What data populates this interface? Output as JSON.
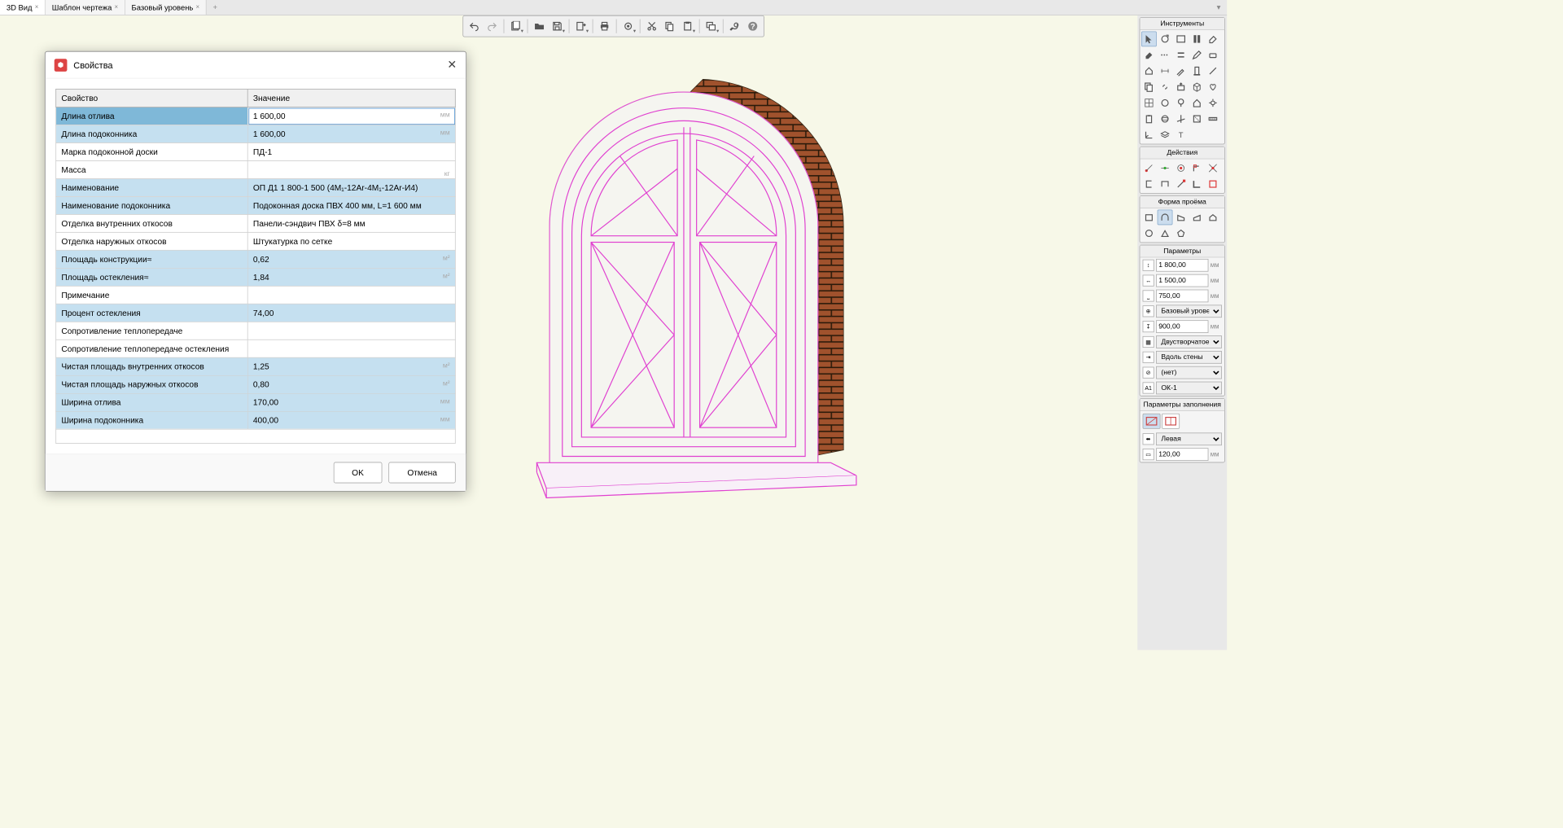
{
  "tabs": {
    "t0": "3D Вид",
    "t1": "Шаблон чертежа",
    "t2": "Базовый уровень"
  },
  "dialog": {
    "title": "Свойства",
    "col_prop": "Свойство",
    "col_val": "Значение",
    "rows": [
      {
        "p": "Длина отлива",
        "v": "1 600,00",
        "u": "мм",
        "sel": 1
      },
      {
        "p": "Длина подоконника",
        "v": "1 600,00",
        "u": "мм",
        "hl": 1
      },
      {
        "p": "Марка подоконной доски",
        "v": "ПД-1"
      },
      {
        "p": "Масса",
        "v": "",
        "u": "кг"
      },
      {
        "p": "Наименование",
        "v": "ОП Д1 1 800-1 500 (4М₁-12Ar-4М₁-12Ar-И4)",
        "hl": 1
      },
      {
        "p": "Наименование подоконника",
        "v": "Подоконная доска ПВХ 400 мм, L=1 600 мм",
        "hl": 1
      },
      {
        "p": "Отделка внутренних откосов",
        "v": "Панели-сэндвич ПВХ δ=8 мм"
      },
      {
        "p": "Отделка наружных откосов",
        "v": "Штукатурка по сетке"
      },
      {
        "p": "Площадь конструкции≈",
        "v": "0,62",
        "u": "м²",
        "hl": 1
      },
      {
        "p": "Площадь остекления≈",
        "v": "1,84",
        "u": "м²",
        "hl": 1
      },
      {
        "p": "Примечание",
        "v": ""
      },
      {
        "p": "Процент остекления",
        "v": "74,00",
        "hl": 1
      },
      {
        "p": "Сопротивление теплопередаче",
        "v": ""
      },
      {
        "p": "Сопротивление теплопередаче остекления",
        "v": ""
      },
      {
        "p": "Чистая площадь внутренних откосов",
        "v": "1,25",
        "u": "м²",
        "hl": 1
      },
      {
        "p": "Чистая площадь наружных откосов",
        "v": "0,80",
        "u": "м²",
        "hl": 1
      },
      {
        "p": "Ширина отлива",
        "v": "170,00",
        "u": "мм",
        "hl": 1
      },
      {
        "p": "Ширина подоконника",
        "v": "400,00",
        "u": "мм",
        "hl": 1
      }
    ],
    "ok": "OK",
    "cancel": "Отмена"
  },
  "panels": {
    "tools": "Инструменты",
    "actions": "Действия",
    "shape": "Форма проёма",
    "params": "Параметры",
    "fill": "Параметры заполнения"
  },
  "params": {
    "h": "1 800,00",
    "w": "1 500,00",
    "sill": "750,00",
    "level": "Базовый уровень",
    "off": "900,00",
    "type": "Двустворчатое",
    "along": "Вдоль стены",
    "none": "(нет)",
    "mark": "ОК-1",
    "side": "Левая",
    "v120": "120,00",
    "mm": "мм"
  }
}
